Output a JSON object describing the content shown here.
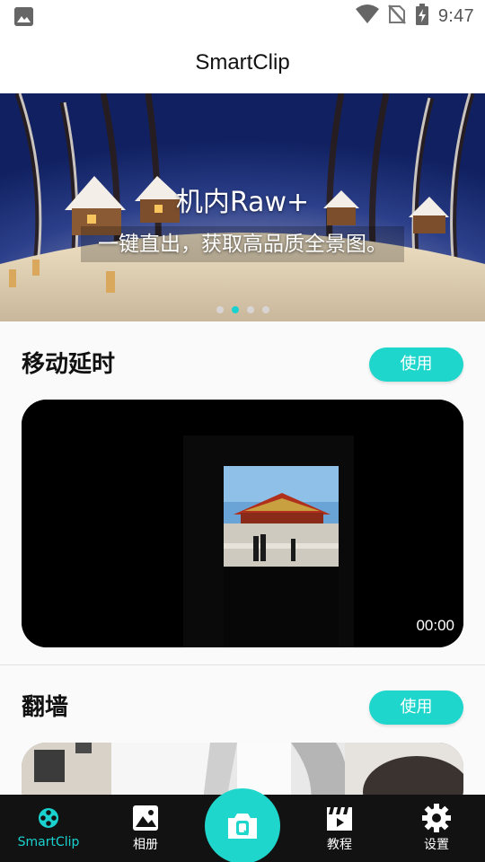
{
  "status_bar": {
    "time": "9:47",
    "icons": [
      "gallery-notification-icon",
      "wifi-icon",
      "no-sim-icon",
      "battery-charging-icon"
    ]
  },
  "header": {
    "title": "SmartClip"
  },
  "banner": {
    "title": "机内Raw+",
    "subtitle": "一键直出，获取高品质全景图。",
    "page_count": 4,
    "active_page": 2,
    "accent_color": "#19d2cf"
  },
  "sections": [
    {
      "title": "移动延时",
      "button_label": "使用",
      "video_time": "00:00"
    },
    {
      "title": "翻墙",
      "button_label": "使用"
    }
  ],
  "bottom_nav": {
    "items": [
      {
        "label": "SmartClip",
        "icon": "film-reel-icon",
        "active": true
      },
      {
        "label": "相册",
        "icon": "image-icon",
        "active": false
      },
      {
        "label": "",
        "icon": "camera-icon",
        "active": false
      },
      {
        "label": "教程",
        "icon": "clapperboard-play-icon",
        "active": false
      },
      {
        "label": "设置",
        "icon": "gear-icon",
        "active": false
      }
    ]
  },
  "colors": {
    "accent": "#1fd6cc",
    "nav_background": "#121212",
    "page_background": "#fafafa"
  }
}
